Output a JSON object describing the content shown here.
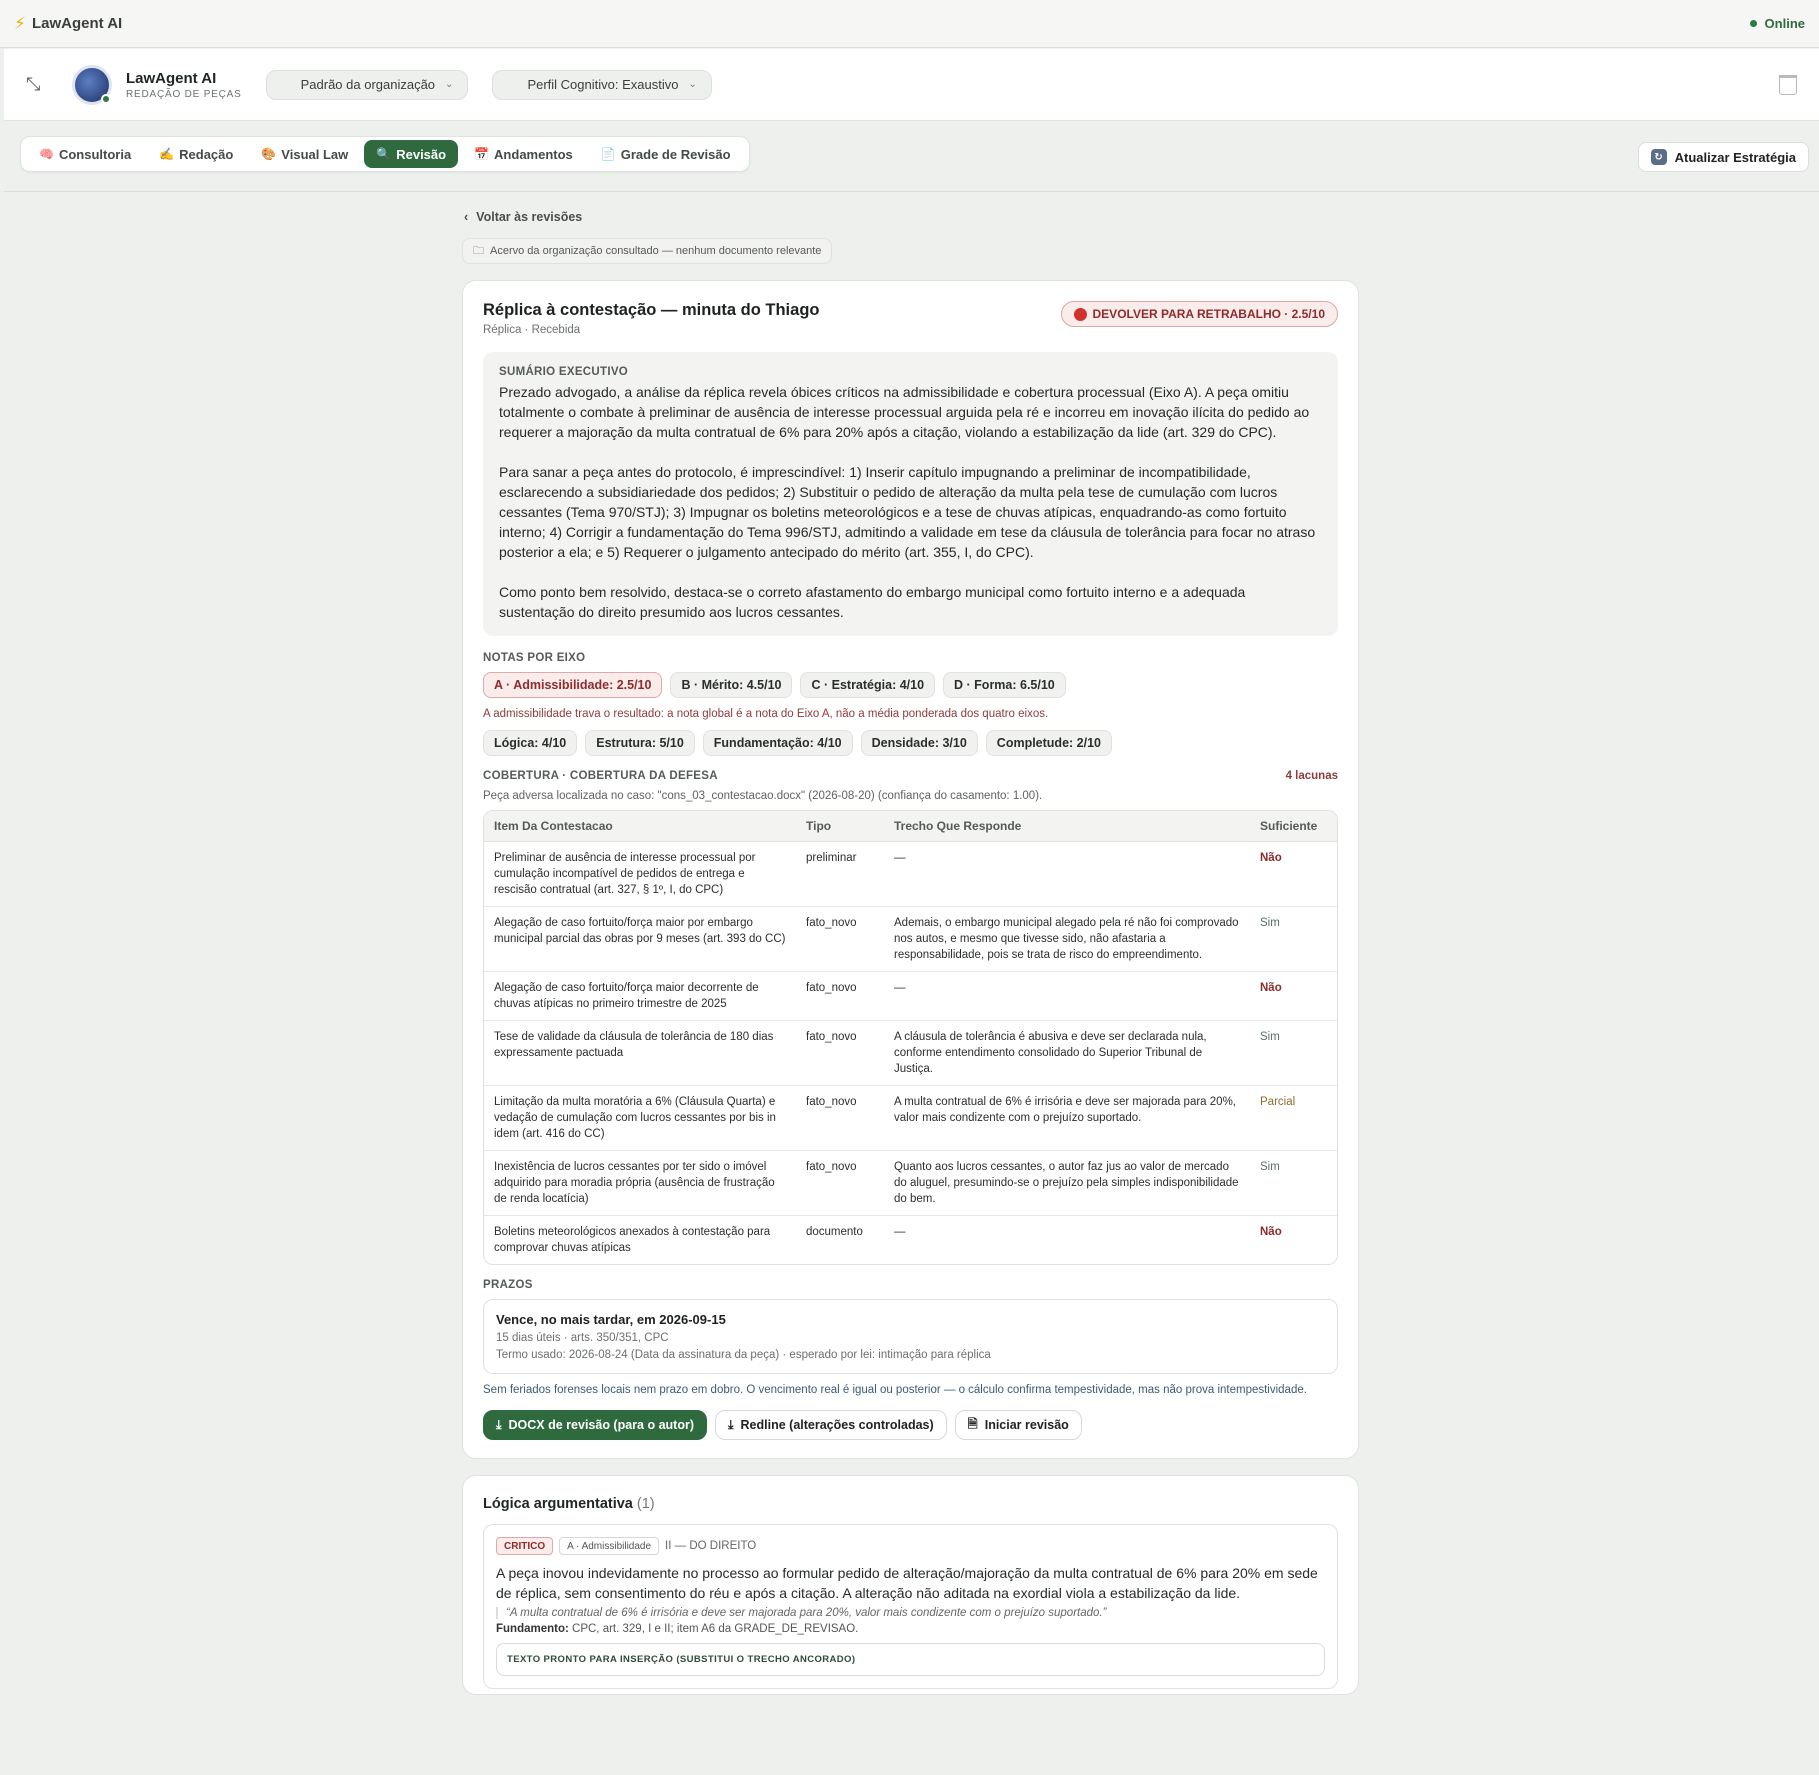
{
  "app": {
    "name": "LawAgent AI",
    "status": "Online"
  },
  "header": {
    "agent_name": "LawAgent AI",
    "agent_role": "REDAÇÃO DE PEÇAS",
    "org_select": "Padrão da organização",
    "profile_select": "Perfil Cognitivo: Exaustivo"
  },
  "tabs": [
    {
      "label": "Consultoria",
      "icon": "🧠"
    },
    {
      "label": "Redação",
      "icon": "✍️"
    },
    {
      "label": "Visual Law",
      "icon": "🎨"
    },
    {
      "label": "Revisão",
      "icon": "🔍"
    },
    {
      "label": "Andamentos",
      "icon": "📅"
    },
    {
      "label": "Grade de Revisão",
      "icon": "📄"
    }
  ],
  "active_tab": "Revisão",
  "update_button": "Atualizar Estratégia",
  "back_link": "Voltar às revisões",
  "org_note": "Acervo da organização consultado — nenhum documento relevante",
  "review": {
    "title": "Réplica à contestação — minuta do Thiago",
    "subtitle": "Réplica · Recebida",
    "verdict": "DEVOLVER PARA RETRABALHO · 2.5/10",
    "summary_label": "SUMÁRIO EXECUTIVO",
    "summary_p1": "Prezado advogado, a análise da réplica revela óbices críticos na admissibilidade e cobertura processual (Eixo A). A peça omitiu totalmente o combate à preliminar de ausência de interesse processual arguida pela ré e incorreu em inovação ilícita do pedido ao requerer a majoração da multa contratual de 6% para 20% após a citação, violando a estabilização da lide (art. 329 do CPC).",
    "summary_p2": "Para sanar a peça antes do protocolo, é imprescindível: 1) Inserir capítulo impugnando a preliminar de incompatibilidade, esclarecendo a subsidiariedade dos pedidos; 2) Substituir o pedido de alteração da multa pela tese de cumulação com lucros cessantes (Tema 970/STJ); 3) Impugnar os boletins meteorológicos e a tese de chuvas atípicas, enquadrando-as como fortuito interno; 4) Corrigir a fundamentação do Tema 996/STJ, admitindo a validade em tese da cláusula de tolerância para focar no atraso posterior a ela; e 5) Requerer o julgamento antecipado do mérito (art. 355, I, do CPC).",
    "summary_p3": "Como ponto bem resolvido, destaca-se o correto afastamento do embargo municipal como fortuito interno e a adequada sustentação do direito presumido aos lucros cessantes.",
    "axes_label": "NOTAS POR EIXO",
    "axes": [
      "A · Admissibilidade: 2.5/10",
      "B · Mérito: 4.5/10",
      "C · Estratégia: 4/10",
      "D · Forma: 6.5/10"
    ],
    "axes_warning": "A admissibilidade trava o resultado: a nota global é a nota do Eixo A, não a média ponderada dos quatro eixos.",
    "criteria": [
      "Lógica: 4/10",
      "Estrutura: 5/10",
      "Fundamentação: 4/10",
      "Densidade: 3/10",
      "Completude: 2/10"
    ],
    "coverage_label": "COBERTURA · COBERTURA DA DEFESA",
    "coverage_gaps": "4 lacunas",
    "coverage_note": "Peça adversa localizada no caso: \"cons_03_contestacao.docx\" (2026-08-20) (confiança do casamento: 1.00).",
    "table_headers": [
      "Item Da Contestacao",
      "Tipo",
      "Trecho Que Responde",
      "Suficiente"
    ],
    "rows": [
      {
        "item": "Preliminar de ausência de interesse processual por cumulação incompatível de pedidos de entrega e rescisão contratual (art. 327, § 1º, I, do CPC)",
        "tipo": "preliminar",
        "trecho": "—",
        "suf": "Não"
      },
      {
        "item": "Alegação de caso fortuito/força maior por embargo municipal parcial das obras por 9 meses (art. 393 do CC)",
        "tipo": "fato_novo",
        "trecho": "Ademais, o embargo municipal alegado pela ré não foi comprovado nos autos, e mesmo que tivesse sido, não afastaria a responsabilidade, pois se trata de risco do empreendimento.",
        "suf": "Sim"
      },
      {
        "item": "Alegação de caso fortuito/força maior decorrente de chuvas atípicas no primeiro trimestre de 2025",
        "tipo": "fato_novo",
        "trecho": "—",
        "suf": "Não"
      },
      {
        "item": "Tese de validade da cláusula de tolerância de 180 dias expressamente pactuada",
        "tipo": "fato_novo",
        "trecho": "A cláusula de tolerância é abusiva e deve ser declarada nula, conforme entendimento consolidado do Superior Tribunal de Justiça.",
        "suf": "Sim"
      },
      {
        "item": "Limitação da multa moratória a 6% (Cláusula Quarta) e vedação de cumulação com lucros cessantes por bis in idem (art. 416 do CC)",
        "tipo": "fato_novo",
        "trecho": "A multa contratual de 6% é irrisória e deve ser majorada para 20%, valor mais condizente com o prejuízo suportado.",
        "suf": "Parcial"
      },
      {
        "item": "Inexistência de lucros cessantes por ter sido o imóvel adquirido para moradia própria (ausência de frustração de renda locatícia)",
        "tipo": "fato_novo",
        "trecho": "Quanto aos lucros cessantes, o autor faz jus ao valor de mercado do aluguel, presumindo-se o prejuízo pela simples indisponibilidade do bem.",
        "suf": "Sim"
      },
      {
        "item": "Boletins meteorológicos anexados à contestação para comprovar chuvas atípicas",
        "tipo": "documento",
        "trecho": "—",
        "suf": "Não"
      }
    ],
    "deadlines_label": "PRAZOS",
    "deadline_main": "Vence, no mais tardar, em 2026-09-15",
    "deadline_days": "15 dias úteis · arts. 350/351, CPC",
    "deadline_term": "Termo usado: 2026-08-24 (Data da assinatura da peça) · esperado por lei: intimação para réplica",
    "deadline_note": "Sem feriados forenses locais nem prazo em dobro. O vencimento real é igual ou posterior — o cálculo confirma tempestividade, mas não prova intempestividade.",
    "btn_docx": "DOCX de revisão (para o autor)",
    "btn_redline": "Redline (alterações controladas)",
    "btn_start": "Iniciar revisão"
  },
  "logic": {
    "title": "Lógica argumentativa",
    "count": "(1)",
    "severity": "CRITICO",
    "axis": "A · Admissibilidade",
    "section": "II — DO DIREITO",
    "text": "A peça inovou indevidamente no processo ao formular pedido de alteração/majoração da multa contratual de 6% para 20% em sede de réplica, sem consentimento do réu e após a citação. A alteração não aditada na exordial viola a estabilização da lide.",
    "quote": "“A multa contratual de 6% é irrisória e deve ser majorada para 20%, valor mais condizente com o prejuízo suportado.”",
    "fund_label": "Fundamento:",
    "fund_text": "CPC, art. 329, I e II; item A6 da GRADE_DE_REVISAO.",
    "insert_label": "TEXTO PRONTO PARA INSERÇÃO (SUBSTITUI O TRECHO ANCORADO)"
  }
}
